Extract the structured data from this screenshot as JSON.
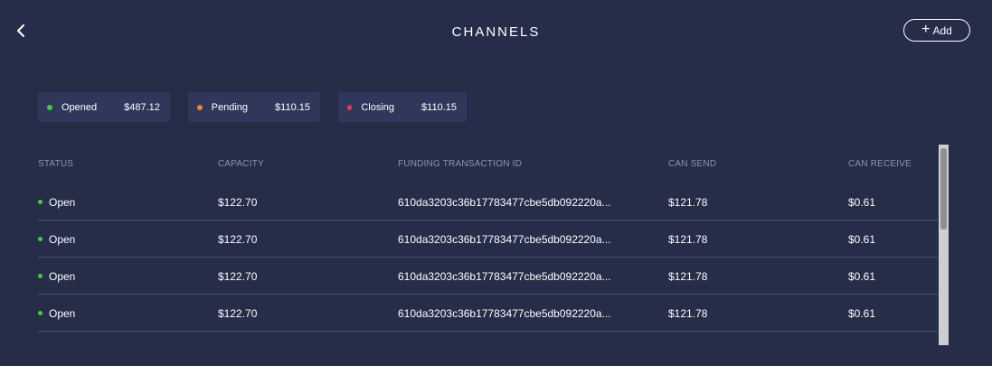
{
  "header": {
    "title": "CHANNELS",
    "add_label": "Add"
  },
  "summary": [
    {
      "label": "Opened",
      "amount": "$487.12",
      "color": "#3bd13b"
    },
    {
      "label": "Pending",
      "amount": "$110.15",
      "color": "#f2831f"
    },
    {
      "label": "Closing",
      "amount": "$110.15",
      "color": "#e8365d"
    }
  ],
  "table": {
    "columns": [
      "STATUS",
      "CAPACITY",
      "FUNDING TRANSACTION ID",
      "CAN SEND",
      "CAN RECEIVE"
    ],
    "rows": [
      {
        "status": "Open",
        "capacity": "$122.70",
        "txid": "610da3203c36b17783477cbe5db092220a...",
        "can_send": "$121.78",
        "can_receive": "$0.61"
      },
      {
        "status": "Open",
        "capacity": "$122.70",
        "txid": "610da3203c36b17783477cbe5db092220a...",
        "can_send": "$121.78",
        "can_receive": "$0.61"
      },
      {
        "status": "Open",
        "capacity": "$122.70",
        "txid": "610da3203c36b17783477cbe5db092220a...",
        "can_send": "$121.78",
        "can_receive": "$0.61"
      },
      {
        "status": "Open",
        "capacity": "$122.70",
        "txid": "610da3203c36b17783477cbe5db092220a...",
        "can_send": "$121.78",
        "can_receive": "$0.61"
      }
    ]
  },
  "colors": {
    "background": "#252d48",
    "card": "#2f385a",
    "status_open": "#3bd13b",
    "header_text": "#8e94a8"
  },
  "icons": {
    "back": "chevron-left-icon",
    "add": "plus-icon"
  }
}
